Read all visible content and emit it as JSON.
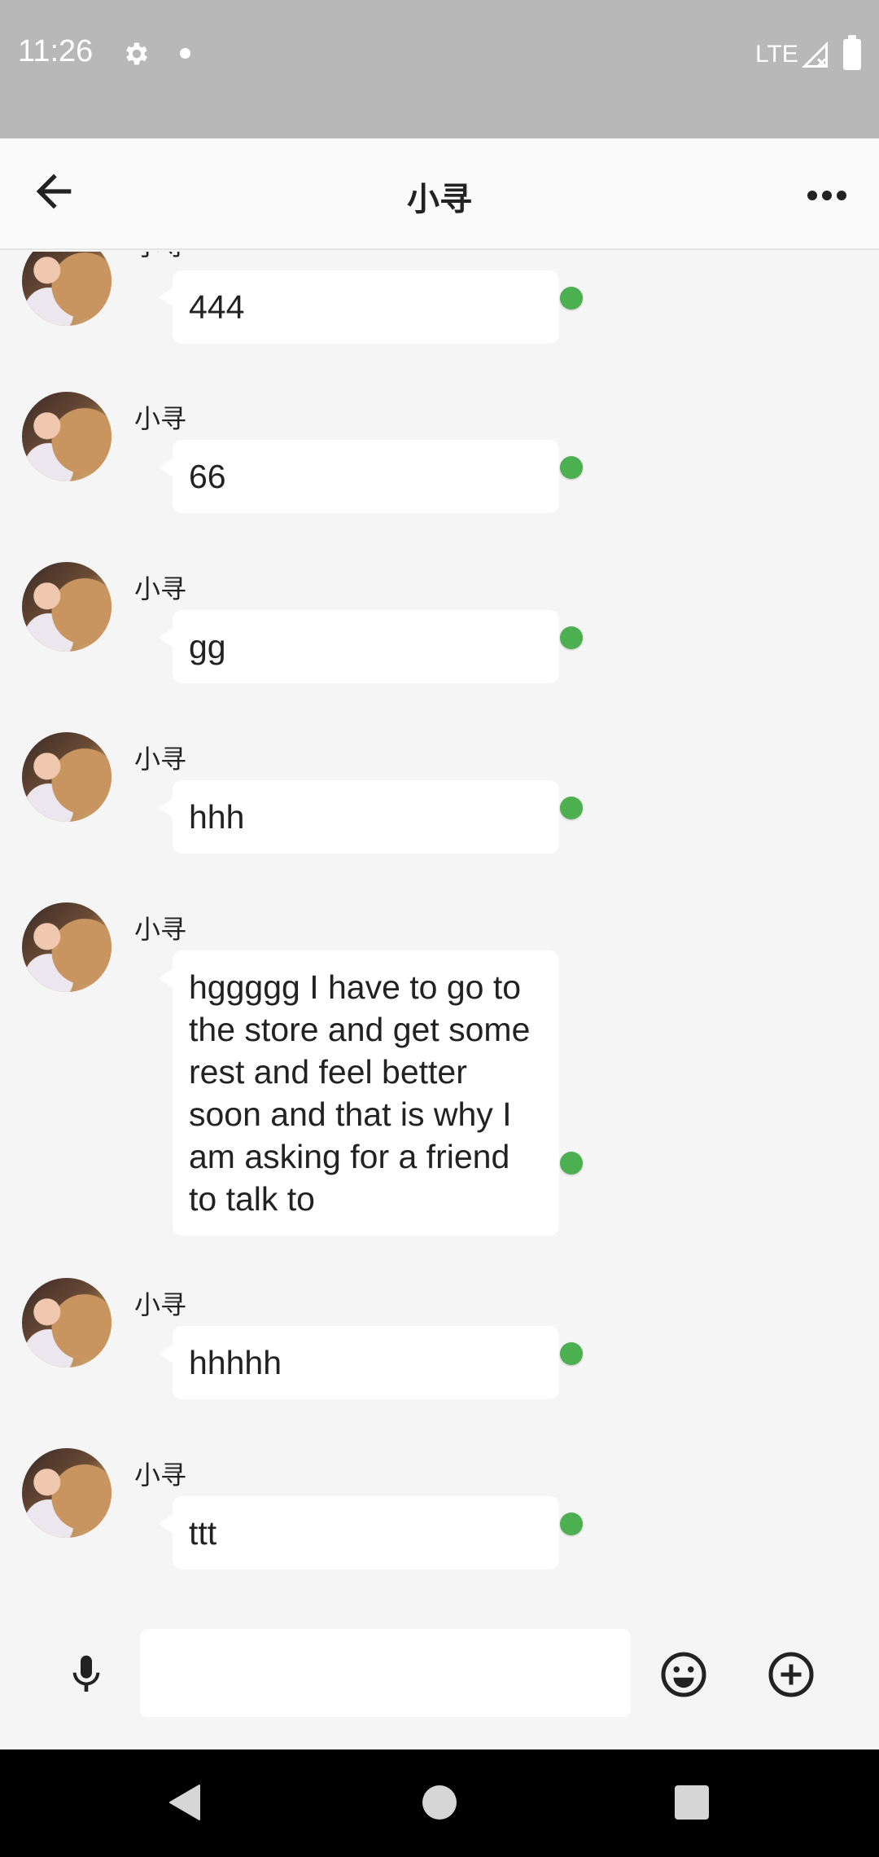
{
  "status_bar": {
    "time": "11:26",
    "network": "LTE"
  },
  "header": {
    "title": "小寻"
  },
  "messages": [
    {
      "sender": "小寻",
      "text": "444"
    },
    {
      "sender": "小寻",
      "text": "66"
    },
    {
      "sender": "小寻",
      "text": "gg"
    },
    {
      "sender": "小寻",
      "text": "hhh"
    },
    {
      "sender": "小寻",
      "text": "hggggg I have to go to the store and get some rest and feel better soon and that is why I am asking for a friend to talk to"
    },
    {
      "sender": "小寻",
      "text": "hhhhh"
    },
    {
      "sender": "小寻",
      "text": "ttt"
    }
  ],
  "input": {
    "value": "",
    "placeholder": ""
  },
  "colors": {
    "status_indicator": "#4caf50",
    "status_bar_bg": "#b8b8b8",
    "chat_bg": "#f5f5f5"
  },
  "icons": {
    "back": "arrow-left-icon",
    "more": "more-horizontal-icon",
    "mic": "mic-icon",
    "emoji": "emoji-icon",
    "add": "add-circle-icon",
    "settings": "gear-icon",
    "signal": "signal-icon",
    "battery": "battery-icon"
  }
}
